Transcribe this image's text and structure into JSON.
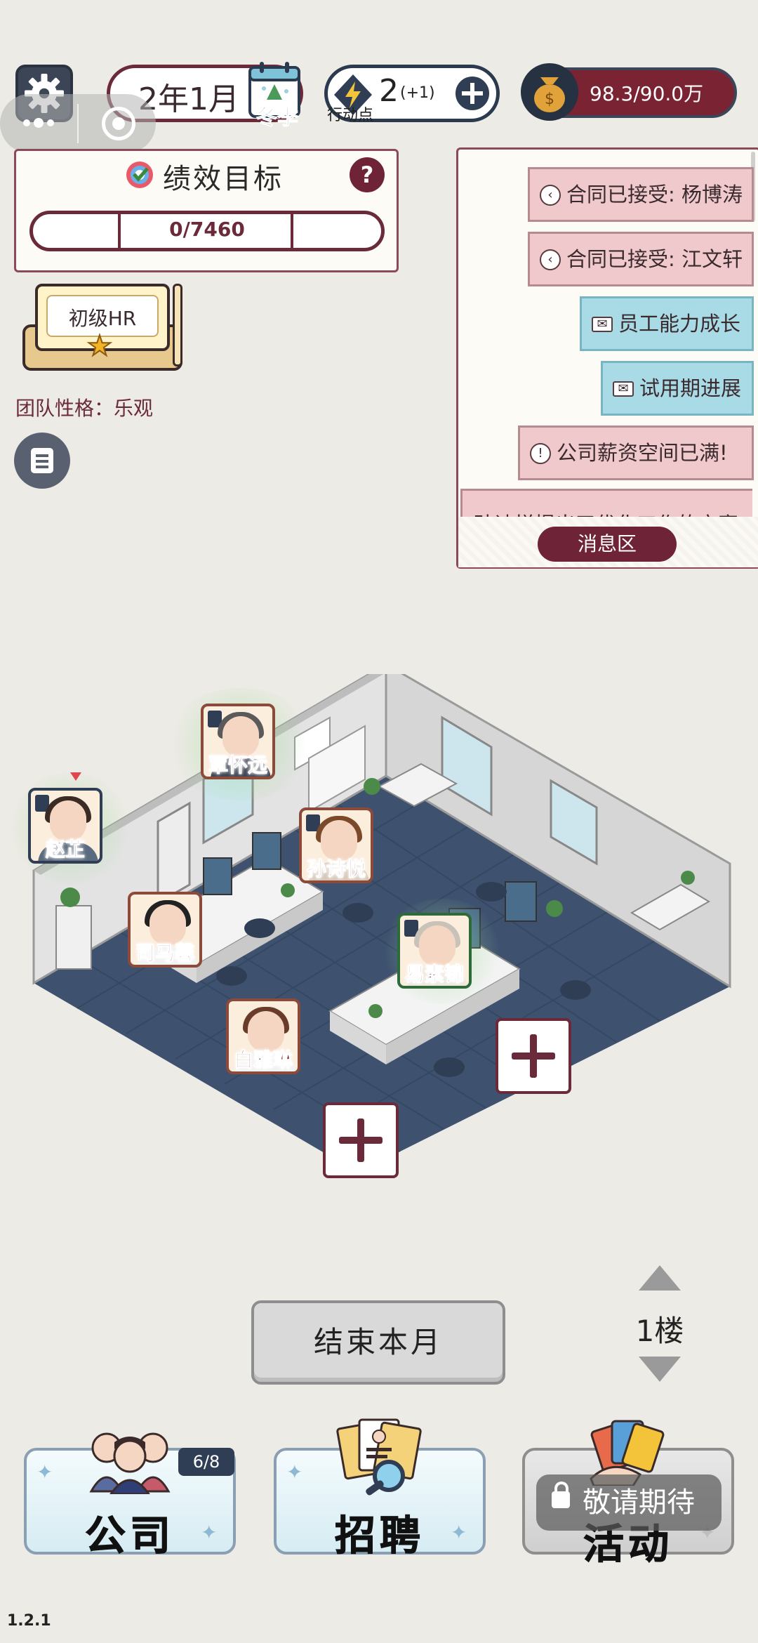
{
  "top_bar": {
    "date": "2年1月",
    "season": "冬季",
    "action_points": "2",
    "action_points_bonus": "(+1)",
    "action_points_label": "行动点",
    "money": "98.3/90.0万"
  },
  "performance": {
    "title": "绩效目标",
    "help": "?",
    "progress": "0/7460",
    "progress_fraction": 0
  },
  "hr_rank": {
    "label": "初级HR"
  },
  "team_trait": "团队性格：乐观",
  "messages": {
    "items": [
      {
        "text": "合同已接受: 杨博涛",
        "type": "contract",
        "icon": "arrow-left-icon"
      },
      {
        "text": "合同已接受: 江文轩",
        "type": "contract",
        "icon": "arrow-left-icon"
      },
      {
        "text": "员工能力成长",
        "type": "mail",
        "icon": "mail-icon"
      },
      {
        "text": "试用期进展",
        "type": "mail",
        "icon": "mail-icon"
      },
      {
        "text": "公司薪资空间已满!",
        "type": "alert",
        "icon": "alert-icon"
      }
    ],
    "partial_text": "孙诗悦提出了优化工作的方案",
    "label": "消息区"
  },
  "employees": [
    {
      "name": "覃怀远"
    },
    {
      "name": "赵芷"
    },
    {
      "name": "孙诗悦"
    },
    {
      "name": "司马馨"
    },
    {
      "name": "易素锦"
    },
    {
      "name": "白雅琳"
    }
  ],
  "controls": {
    "end_month": "结束本月",
    "floor": "1楼"
  },
  "tabs": {
    "company": "公司",
    "company_count": "6/8",
    "recruit": "招聘",
    "activity_partial": "活动",
    "locked_label": "敬请期待"
  },
  "version": "1.2.1",
  "colors": {
    "maroon": "#6b2a3a",
    "navy": "#2f3e55",
    "message_red": "#efc9cb",
    "message_blue": "#a8dbe6",
    "background": "#ecebe5"
  }
}
